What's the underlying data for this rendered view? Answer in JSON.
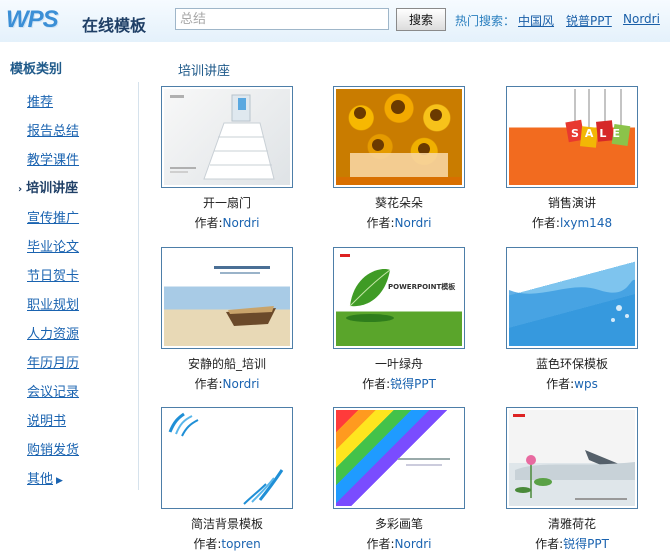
{
  "header": {
    "logo_text": "WPS",
    "title": "在线模板",
    "search": {
      "value": "",
      "placeholder": "总结",
      "button_label": "搜索"
    },
    "hot_label": "热门搜索：",
    "hot_links": [
      "中国风",
      "锐普PPT",
      "Nordri"
    ]
  },
  "sidebar": {
    "title": "模板类别",
    "items": [
      {
        "label": "推荐"
      },
      {
        "label": "报告总结"
      },
      {
        "label": "教学课件"
      },
      {
        "label": "培训讲座",
        "active": true
      },
      {
        "label": "宣传推广"
      },
      {
        "label": "毕业论文"
      },
      {
        "label": "节日贺卡"
      },
      {
        "label": "职业规划"
      },
      {
        "label": "人力资源"
      },
      {
        "label": "年历月历"
      },
      {
        "label": "会议记录"
      },
      {
        "label": "说明书"
      },
      {
        "label": "购销发货"
      },
      {
        "label": "其他"
      }
    ]
  },
  "main": {
    "section_title": "培训讲座",
    "author_prefix": "作者:",
    "templates": [
      {
        "name": "开一扇门",
        "author": "Nordri"
      },
      {
        "name": "葵花朵朵",
        "author": "Nordri"
      },
      {
        "name": "销售演讲",
        "author": "lxym148"
      },
      {
        "name": "安静的船_培训",
        "author": "Nordri"
      },
      {
        "name": "一叶绿舟",
        "author": "锐得PPT"
      },
      {
        "name": "蓝色环保模板",
        "author": "wps"
      },
      {
        "name": "简洁背景模板",
        "author": "topren"
      },
      {
        "name": "多彩画笔",
        "author": "Nordri"
      },
      {
        "name": "清雅荷花",
        "author": "锐得PPT"
      }
    ],
    "thumb_text": {
      "sale": "SALE",
      "powerpoint": "POWERPOINT模板"
    }
  },
  "colors": {
    "link": "#1a63b0",
    "header_bg": "#e4f1fb",
    "thumb_border": "#4d7ea8"
  }
}
